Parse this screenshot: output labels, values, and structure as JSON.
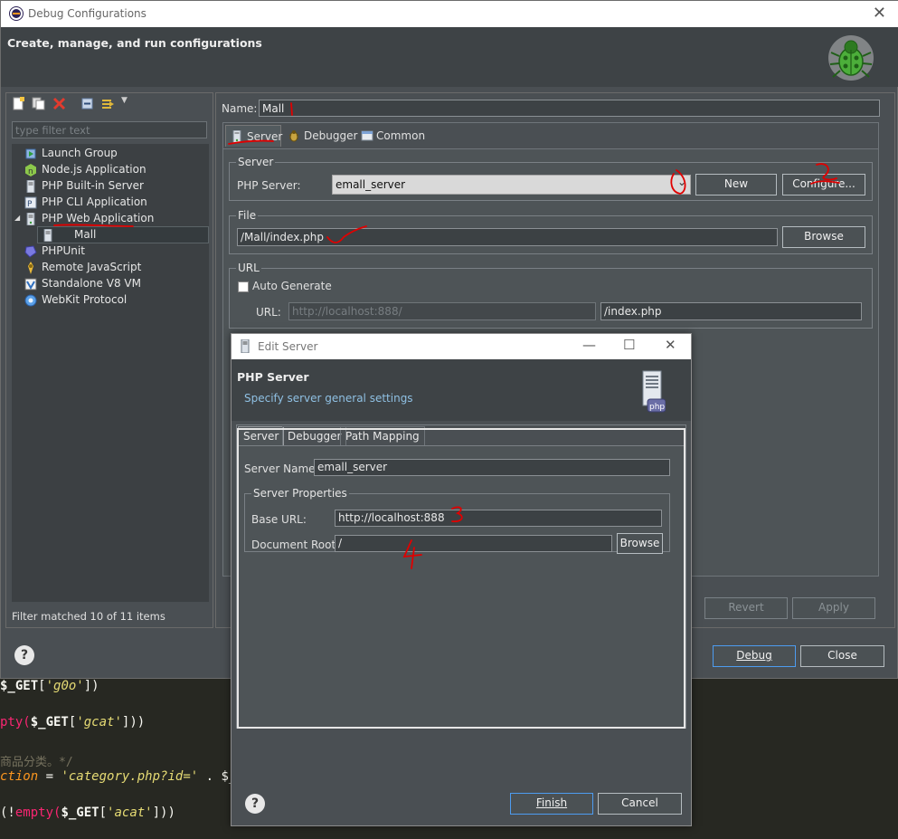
{
  "window": {
    "title": "Debug Configurations",
    "heading": "Create, manage, and run configurations"
  },
  "left_panel": {
    "filter_placeholder": "type filter text",
    "tree": [
      {
        "label": "Launch Group",
        "icon": "launch-group-icon"
      },
      {
        "label": "Node.js Application",
        "icon": "nodejs-icon"
      },
      {
        "label": "PHP Built-in Server",
        "icon": "php-server-icon"
      },
      {
        "label": "PHP CLI Application",
        "icon": "php-cli-icon"
      },
      {
        "label": "PHP Web Application",
        "icon": "php-web-icon",
        "expanded": true
      },
      {
        "label": "Mall",
        "icon": "php-web-icon",
        "child": true,
        "selected": true
      },
      {
        "label": "PHPUnit",
        "icon": "phpunit-icon"
      },
      {
        "label": "Remote JavaScript",
        "icon": "remote-js-icon"
      },
      {
        "label": "Standalone V8 VM",
        "icon": "v8-icon"
      },
      {
        "label": "WebKit Protocol",
        "icon": "webkit-icon"
      }
    ],
    "filter_status": "Filter matched 10 of 11 items"
  },
  "config": {
    "name_label": "Name:",
    "name_value": "Mall",
    "tabs": [
      {
        "label": "Server",
        "icon": "server-icon",
        "active": true
      },
      {
        "label": "Debugger",
        "icon": "bug-icon"
      },
      {
        "label": "Common",
        "icon": "common-icon"
      }
    ],
    "server_group": "Server",
    "php_server_label": "PHP Server:",
    "php_server_value": "emall_server",
    "new_label": "New",
    "configure_label": "Configure...",
    "file_group": "File",
    "file_value": "/Mall/index.php",
    "browse_label": "Browse",
    "url_group": "URL",
    "auto_generate_label": "Auto Generate",
    "url_label": "URL:",
    "url_base": "http://localhost:888/",
    "url_path": "/index.php",
    "revert_label": "Revert",
    "apply_label": "Apply"
  },
  "footer": {
    "debug_label": "Debug",
    "close_label": "Close"
  },
  "edit_server": {
    "title": "Edit Server",
    "heading": "PHP Server",
    "subheading": "Specify server general settings",
    "tabs": [
      "Server",
      "Debugger",
      "Path Mapping"
    ],
    "server_name_label": "Server Name:",
    "server_name_value": "emall_server",
    "props_group": "Server Properties",
    "base_url_label": "Base URL:",
    "base_url_value": "http://localhost:888",
    "doc_root_label": "Document Root:",
    "doc_root_value": "/",
    "browse_label": "Browse",
    "finish_label": "Finish",
    "cancel_label": "Cancel"
  },
  "annotations": [
    "1",
    "2",
    "3",
    "4"
  ],
  "code": {
    "line1_var": "$_GET",
    "line1_str": "'g0o'",
    "line2_kw": "pty(",
    "line2_var": "$_GET",
    "line2_str": "'gcat'",
    "line3_comment": "商品分类。*/",
    "line4_fn": "ction",
    "line4_str": "'category.php?id='",
    "line4_tail": " . $_G",
    "line5_kw": "empty(",
    "line5_var": "$_GET",
    "line5_str": "'acat'"
  },
  "colors": {
    "annotation_red": "#e00000",
    "default_button_border": "#4d9cf0"
  }
}
